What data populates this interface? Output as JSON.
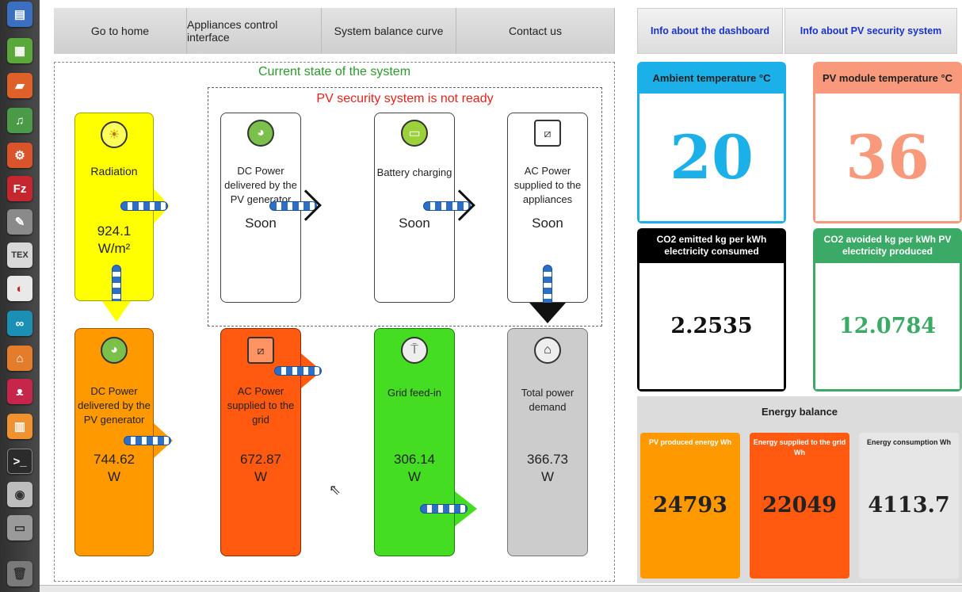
{
  "nav": {
    "home": "Go to home",
    "appliances": "Appliances control interface",
    "balance_curve": "System balance curve",
    "contact": "Contact us"
  },
  "info": {
    "dashboard": "Info about the dashboard",
    "security": "Info about PV security system"
  },
  "main": {
    "title": "Current state of the system",
    "security_status": "PV security system is not ready"
  },
  "cards": {
    "radiation": {
      "label": "Radiation",
      "value": "924.1",
      "unit": "W/m²"
    },
    "dc_top": {
      "label": "DC Power delivered by the PV generator",
      "value": "Soon"
    },
    "battery": {
      "label": "Battery charging",
      "value": "Soon"
    },
    "ac_top": {
      "label": "AC Power supplied to the appliances",
      "value": "Soon"
    },
    "dc_bottom": {
      "label": "DC Power delivered by the PV generator",
      "value": "744.62",
      "unit": "W"
    },
    "ac_grid": {
      "label": "AC Power supplied to the grid",
      "value": "672.87",
      "unit": "W"
    },
    "grid_feed": {
      "label": "Grid feed-in",
      "value": "306.14",
      "unit": "W"
    },
    "total": {
      "label": "Total power demand",
      "value": "366.73",
      "unit": "W"
    }
  },
  "tiles": {
    "ambient": {
      "label": "Ambient temperature °C",
      "value": "20"
    },
    "module": {
      "label": "PV module temperature °C",
      "value": "36"
    },
    "co2_emitted": {
      "label": "CO2 emitted kg per kWh electricity consumed",
      "value": "2.2535"
    },
    "co2_avoided": {
      "label": "CO2 avoided kg per kWh PV electricity produced",
      "value": "12.0784"
    }
  },
  "energy": {
    "title": "Energy balance",
    "produced": {
      "label": "PV produced energy Wh",
      "value": "24793"
    },
    "supplied": {
      "label": "Energy supplied to the grid Wh",
      "value": "22049"
    },
    "consumption": {
      "label": "Energy consumption Wh",
      "value": "4113.7"
    }
  },
  "launcher": {
    "tex_label": "TEX",
    "fz_label": "Fz"
  },
  "colors": {
    "yellow": "#ffff00",
    "orange": "#ff9900",
    "red_orange": "#ff5a10",
    "green": "#44dd22",
    "grey": "#cccccc",
    "cyan": "#1cb0e8",
    "salmon": "#f7997a",
    "co2_green": "#3aaa66"
  }
}
